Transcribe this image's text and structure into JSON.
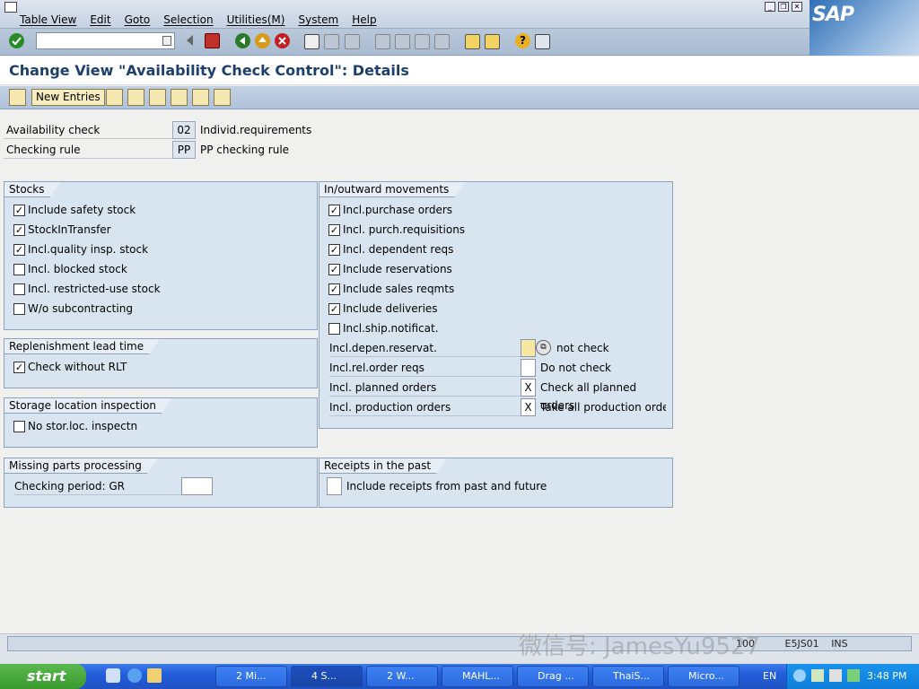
{
  "menubar": {
    "items": [
      "Table View",
      "Edit",
      "Goto",
      "Selection",
      "Utilities(M)",
      "System",
      "Help"
    ]
  },
  "brand": {
    "logo_text": "SAP"
  },
  "toolbar": {
    "command_field_value": ""
  },
  "title": "Change View \"Availability Check Control\": Details",
  "app_toolbar": {
    "new_entries_label": "New Entries"
  },
  "header": {
    "availability_check_label": "Availability check",
    "availability_check_value": "02",
    "availability_check_text": "Individ.requirements",
    "checking_rule_label": "Checking rule",
    "checking_rule_value": "PP",
    "checking_rule_text": "PP checking rule"
  },
  "stocks": {
    "title": "Stocks",
    "items": [
      {
        "label": "Include safety stock",
        "checked": true
      },
      {
        "label": "StockInTransfer",
        "checked": true
      },
      {
        "label": "Incl.quality insp. stock",
        "checked": true
      },
      {
        "label": "Incl. blocked stock",
        "checked": false
      },
      {
        "label": "Incl. restricted-use stock",
        "checked": false
      },
      {
        "label": "W/o subcontracting",
        "checked": false
      }
    ]
  },
  "replenishment": {
    "title": "Replenishment lead time",
    "items": [
      {
        "label": "Check without RLT",
        "checked": true
      }
    ]
  },
  "storage": {
    "title": "Storage location inspection",
    "items": [
      {
        "label": "No stor.loc. inspectn",
        "checked": false
      }
    ]
  },
  "missing_parts": {
    "title": "Missing parts processing",
    "field_label": "Checking period: GR",
    "field_value": ""
  },
  "movements": {
    "title": "In/outward movements",
    "items": [
      {
        "label": "Incl.purchase orders",
        "checked": true
      },
      {
        "label": "Incl. purch.requisitions",
        "checked": true
      },
      {
        "label": "Incl. dependent reqs",
        "checked": true
      },
      {
        "label": "Include reservations",
        "checked": true
      },
      {
        "label": "Include sales reqmts",
        "checked": true
      },
      {
        "label": "Include deliveries",
        "checked": true
      },
      {
        "label": "Incl.ship.notificat.",
        "checked": false
      }
    ],
    "fields": [
      {
        "label": "Incl.depen.reservat.",
        "value": "",
        "text": "not check"
      },
      {
        "label": "Incl.rel.order reqs",
        "value": "",
        "text": "Do not check"
      },
      {
        "label": "Incl. planned orders",
        "value": "X",
        "text": "Check all planned orders"
      },
      {
        "label": "Incl. production orders",
        "value": "X",
        "text": "Take all production orders"
      }
    ]
  },
  "receipts": {
    "title": "Receipts in the past",
    "field_value": "",
    "field_text": "Include receipts from past and future"
  },
  "status": {
    "client": "100",
    "server": "E5JS01",
    "mode": "INS"
  },
  "watermark": "微信号: JamesYu9527",
  "taskbar": {
    "start_label": "start",
    "tasks": [
      "2 Mi...",
      "4 S...",
      "2 W...",
      "MAHL...",
      "Drag ...",
      "ThaiS...",
      "Micro..."
    ],
    "language": "EN",
    "clock": "3:48 PM"
  },
  "colors": {
    "title": "#1c3f6b",
    "group_bg": "#d8e4f0",
    "toolbar": "#afc2da",
    "taskbar": "#245edb"
  }
}
